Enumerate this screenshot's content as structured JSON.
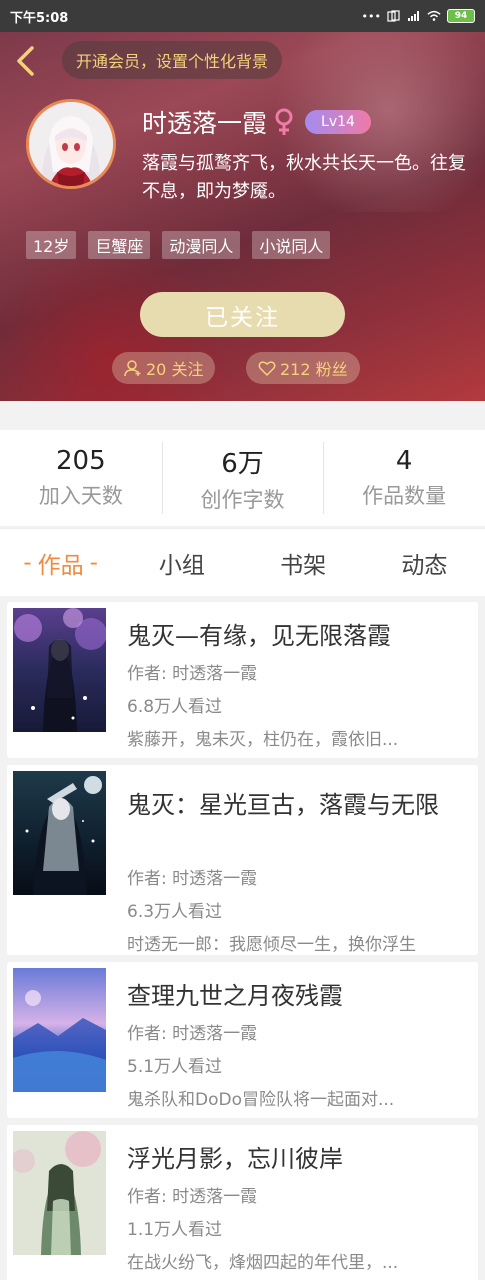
{
  "status_bar": {
    "time": "下午5:08",
    "battery": "94"
  },
  "header": {
    "vip_prompt": "开通会员，设置个性化背景",
    "nickname": "时透落一霞",
    "gender_symbol": "♀",
    "level": "Lv14",
    "bio": "落霞与孤鹜齐飞，秋水共长天一色。往复不息，即为梦魇。",
    "tags": [
      "12岁",
      "巨蟹座",
      "动漫同人",
      "小说同人"
    ],
    "follow_button": "已关注",
    "following_count": "20 关注",
    "fans_count": "212 粉丝"
  },
  "stats": [
    {
      "value": "205",
      "label": "加入天数"
    },
    {
      "value": "6万",
      "label": "创作字数"
    },
    {
      "value": "4",
      "label": "作品数量"
    }
  ],
  "tabs": [
    {
      "label": "作品",
      "active": true
    },
    {
      "label": "小组",
      "active": false
    },
    {
      "label": "书架",
      "active": false
    },
    {
      "label": "动态",
      "active": false
    }
  ],
  "works": [
    {
      "title": "鬼灭—有缘，见无限落霞",
      "author": "作者: 时透落一霞",
      "views": "6.8万人看过",
      "desc": "紫藤开，鬼未灭，柱仍在，霞依旧..."
    },
    {
      "title": "鬼灭：星光亘古，落霞与无限",
      "author": "作者: 时透落一霞",
      "views": "6.3万人看过",
      "desc": "时透无一郎：我愿倾尽一生，换你浮生"
    },
    {
      "title": "查理九世之月夜残霞",
      "author": "作者: 时透落一霞",
      "views": "5.1万人看过",
      "desc": "鬼杀队和DoDo冒险队将一起面对..."
    },
    {
      "title": "浮光月影，忘川彼岸",
      "author": "作者: 时透落一霞",
      "views": "1.1万人看过",
      "desc": "在战火纷飞，烽烟四起的年代里，..."
    }
  ],
  "colors": {
    "accent": "#f08a3c",
    "gold": "#f4d27a",
    "follow_button": "#e7dbb0",
    "header_base": "#8a3a48"
  }
}
